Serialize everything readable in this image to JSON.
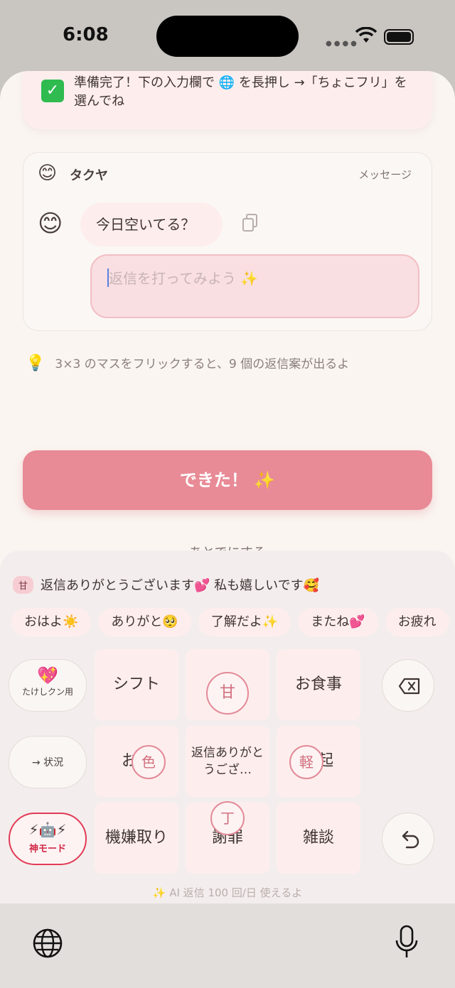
{
  "status_bar": {
    "time": "6:08"
  },
  "banner": {
    "text": "準備完了！下の入力欄で 🌐 を長押し →「ちょこフリ」を選んでね",
    "check_icon": "check-icon"
  },
  "chat_card": {
    "header_emoji": "😊",
    "contact_name": "タクヤ",
    "type_label": "メッセージ",
    "avatar_emoji": "😊",
    "message": "今日空いてる？",
    "reply_placeholder": "返信を打ってみよう ✨"
  },
  "hint": {
    "emoji": "💡",
    "text": "3×3 のマスをフリックすると、9 個の返信案が出るよ"
  },
  "done_button": {
    "label": "できた！ ✨"
  },
  "later_link": {
    "label": "あとでにする"
  },
  "keyboard": {
    "suggestion": {
      "tag": "甘",
      "text": "返信ありがとうございます💕 私も嬉しいです🥰"
    },
    "chips": [
      "おはよ☀️",
      "ありがと🥺",
      "了解だよ✨",
      "またね💕",
      "お疲れ"
    ],
    "left": {
      "profile_emoji": "💖",
      "profile_label": "たけしクン用",
      "situation_label": "→ 状況",
      "god_emoji": "⚡🤖⚡",
      "god_label": "神モード"
    },
    "grid": [
      "シフト",
      "",
      "お食事",
      "お",
      "返信ありがとうござ…",
      "起",
      "機嫌取り",
      "謝罪",
      "雑談"
    ],
    "badges": {
      "top": "甘",
      "left": "色",
      "right": "軽",
      "bottom": "丁"
    },
    "quota": "✨ AI 返信 100 回/日 使えるよ"
  },
  "colors": {
    "accent": "#e88b96",
    "badge": "#e38a98",
    "god": "#e23a55"
  }
}
